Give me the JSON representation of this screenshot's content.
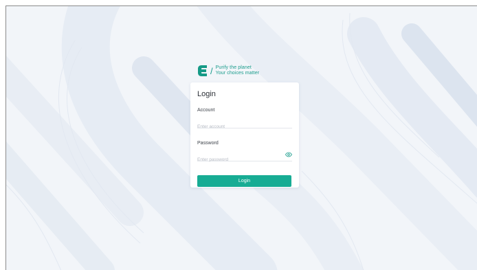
{
  "brand": {
    "slogan_line1": "Purify the planet",
    "slogan_line2": "Your choices matter",
    "logo_icon": "brand-logo-icon",
    "accent_color": "#1a9c8c"
  },
  "login_card": {
    "title": "Login",
    "account": {
      "label": "Account",
      "placeholder": "Enter account",
      "value": ""
    },
    "password": {
      "label": "Password",
      "placeholder": "Enter password",
      "value": "",
      "toggle_icon": "eye-icon"
    },
    "submit_label": "Login",
    "button_color": "#17ac94"
  }
}
